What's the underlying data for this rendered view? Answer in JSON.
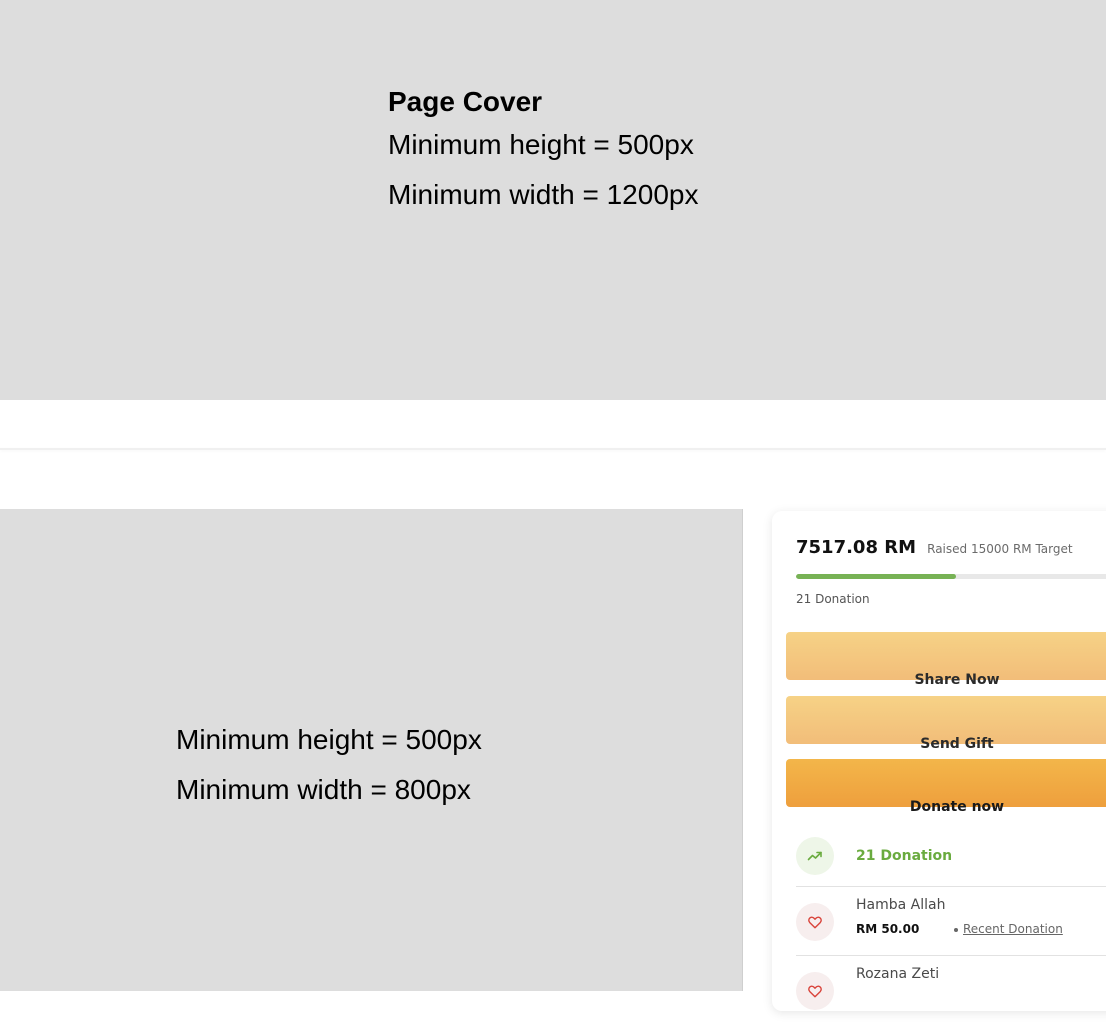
{
  "cover": {
    "title": "Page Cover",
    "min_height": "Minimum height = 500px",
    "min_width": "Minimum width = 1200px"
  },
  "media": {
    "min_height": "Minimum height = 500px",
    "min_width": "Minimum width = 800px"
  },
  "campaign": {
    "raised_amount": "7517.08 RM",
    "raised_target": "Raised 15000 RM Target",
    "progress_fraction": 0.5011,
    "donation_count": "21 Donation",
    "progress_color": "#77b255"
  },
  "actions": {
    "share_label": "Share Now",
    "gift_label": "Send Gift",
    "donate_label": "Donate now"
  },
  "summary": {
    "label": "21 Donation",
    "icon": "trending-up-icon",
    "color": "#6aab3f"
  },
  "donors": [
    {
      "name": "Hamba Allah",
      "amount": "RM 50.00",
      "tag": "Recent Donation",
      "icon": "heart-icon"
    },
    {
      "name": "Rozana Zeti",
      "icon": "heart-icon"
    }
  ]
}
